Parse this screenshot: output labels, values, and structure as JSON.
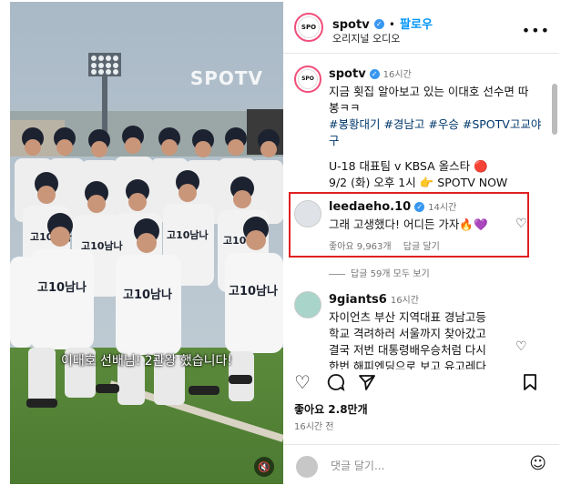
{
  "media": {
    "watermark": "SPOTV",
    "caption": "이대호 선배님! 2관왕 했습니다!",
    "mute_icon": "speaker-muted-icon"
  },
  "header": {
    "username": "spotv",
    "follow_label": "팔로우",
    "audio_label": "오리지널 오디오",
    "avatar_text": "SPO"
  },
  "post": {
    "username": "spotv",
    "time": "16시간",
    "lines": [
      "지금 횟집 알아보고 있는 이대호 선수면 따",
      "봉ㅋㅋ"
    ],
    "tags_line1": "#봉황대기 #경남고 #우승 #SPOTV고교야",
    "tags_line2": "구",
    "info_line1": "U-18 대표팀 v KBSA 올스타 🔴",
    "info_line2": "9/2 (화) 오후 1시 👉 SPOTV NOW"
  },
  "comments": [
    {
      "username": "leedaeho.10",
      "time": "14시간",
      "text": "그래 고생했다! 어디든 가자🔥💜",
      "likes": "좋아요 9,963개",
      "reply": "답글 달기",
      "view_replies": "답글 59개 모두 보기"
    },
    {
      "username": "9giants6",
      "time": "16시간",
      "lines": [
        "자이언츠 부산 지역대표 경남고등",
        "학교 격려하러 서울까지 찾아갔고",
        "결국 저번 대통령배우승처럼 다시",
        "한번 해피엔딩으로 보고 유고레다"
      ]
    }
  ],
  "footer": {
    "likes": "좋아요 2.8만개",
    "time": "16시간 전",
    "comment_placeholder": "댓글 달기..."
  }
}
